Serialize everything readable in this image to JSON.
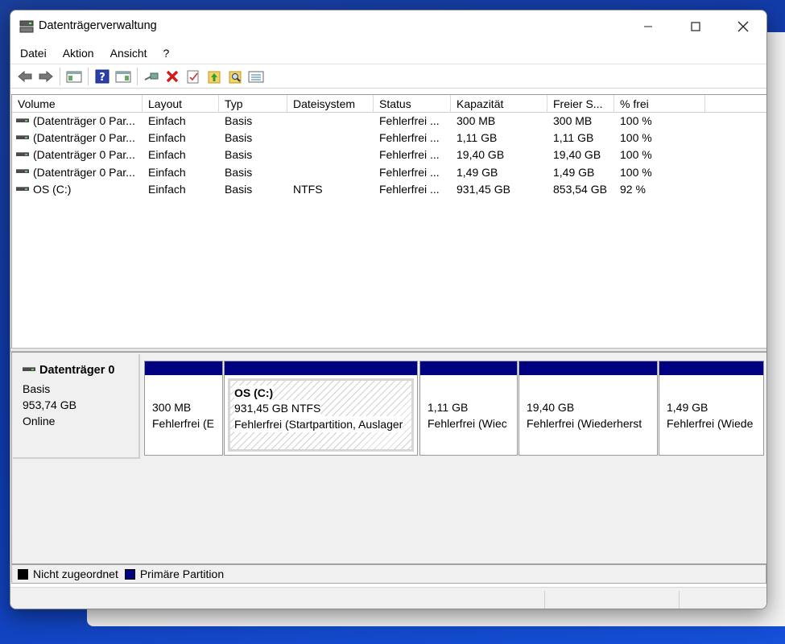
{
  "window": {
    "title": "Datenträgerverwaltung"
  },
  "menu": [
    "Datei",
    "Aktion",
    "Ansicht",
    "?"
  ],
  "toolbar": [
    "back-icon",
    "forward-icon",
    "console-tree-icon",
    "help-icon",
    "action-pane-icon",
    "connect-icon",
    "delete-icon",
    "properties-icon",
    "refresh-icon",
    "search-icon",
    "list-view-icon"
  ],
  "volume_list": {
    "columns": [
      "Volume",
      "Layout",
      "Typ",
      "Dateisystem",
      "Status",
      "Kapazität",
      "Freier S...",
      "% frei"
    ],
    "rows": [
      [
        "(Datenträger 0 Par...",
        "Einfach",
        "Basis",
        "",
        "Fehlerfrei ...",
        "300 MB",
        "300 MB",
        "100 %"
      ],
      [
        "(Datenträger 0 Par...",
        "Einfach",
        "Basis",
        "",
        "Fehlerfrei ...",
        "1,11 GB",
        "1,11 GB",
        "100 %"
      ],
      [
        "(Datenträger 0 Par...",
        "Einfach",
        "Basis",
        "",
        "Fehlerfrei ...",
        "19,40 GB",
        "19,40 GB",
        "100 %"
      ],
      [
        "(Datenträger 0 Par...",
        "Einfach",
        "Basis",
        "",
        "Fehlerfrei ...",
        "1,49 GB",
        "1,49 GB",
        "100 %"
      ],
      [
        "OS (C:)",
        "Einfach",
        "Basis",
        "NTFS",
        "Fehlerfrei ...",
        "931,45 GB",
        "853,54 GB",
        "92 %"
      ]
    ]
  },
  "disk": {
    "name": "Datenträger 0",
    "type": "Basis",
    "size": "953,74 GB",
    "state": "Online",
    "partitions": [
      {
        "title": "",
        "size": "300 MB",
        "status": "Fehlerfrei (E"
      },
      {
        "title": "OS  (C:)",
        "size": "931,45 GB NTFS",
        "status": "Fehlerfrei (Startpartition, Auslager"
      },
      {
        "title": "",
        "size": "1,11 GB",
        "status": "Fehlerfrei (Wiec"
      },
      {
        "title": "",
        "size": "19,40 GB",
        "status": "Fehlerfrei (Wiederherst"
      },
      {
        "title": "",
        "size": "1,49 GB",
        "status": "Fehlerfrei (Wiede"
      }
    ]
  },
  "legend": [
    {
      "label": "Nicht zugeordnet",
      "color": "#000000"
    },
    {
      "label": "Primäre Partition",
      "color": "#000080"
    }
  ]
}
